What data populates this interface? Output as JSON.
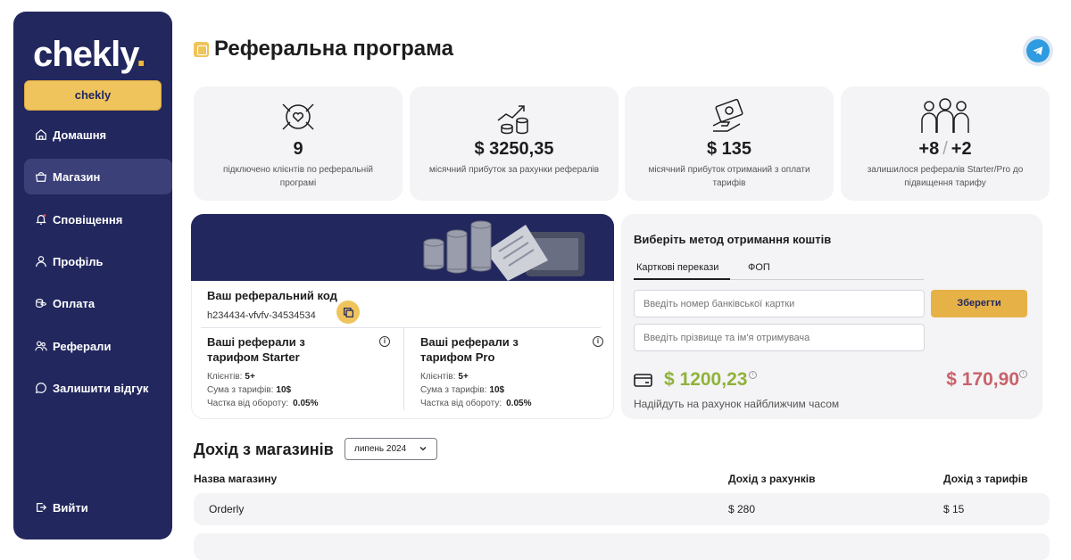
{
  "sidebar": {
    "logo_text": "chekly",
    "logo_dot": ".",
    "user_button": "chekly",
    "items": [
      {
        "label": "Домашня",
        "icon": "home-icon",
        "active": false
      },
      {
        "label": "Магазин",
        "icon": "store-icon",
        "active": true
      },
      {
        "label": "Сповіщення",
        "icon": "bell-icon",
        "active": false
      },
      {
        "label": "Профіль",
        "icon": "user-icon",
        "active": false
      },
      {
        "label": "Оплата",
        "icon": "coins-icon",
        "active": false
      },
      {
        "label": "Реферали",
        "icon": "users-icon",
        "active": false
      },
      {
        "label": "Залишити відгук",
        "icon": "chat-icon",
        "active": false
      }
    ],
    "logout": "Вийти"
  },
  "header": {
    "title": "Реферальна програма"
  },
  "stats": [
    {
      "value": "9",
      "desc": "підключено клієнтів по реферальній програмі",
      "icon": "handshake-heart-icon"
    },
    {
      "value": "$ 3250,35",
      "desc": "місячний прибуток за рахунки рефералів",
      "icon": "growth-coins-icon"
    },
    {
      "value": "$ 135",
      "desc": "місячний прибуток отриманий з оплати тарифів",
      "icon": "money-hand-icon"
    },
    {
      "value_a": "+8",
      "value_sep": "/",
      "value_b": "+2",
      "desc": "залишилося рефералів Starter/Pro до підвищення тарифу",
      "icon": "team-icon"
    }
  ],
  "referral": {
    "code_label": "Ваш реферальний код",
    "code": "h234434-vfvfv-34534534",
    "tiers": [
      {
        "title": "Ваші реферали з тарифом Starter",
        "clients_label": "Клієнтів:",
        "clients": "5+",
        "sum_label": "Сума з тарифів:",
        "sum": "10$",
        "share_label": "Частка від обороту:",
        "share": "0.05%"
      },
      {
        "title": "Ваші реферали з тарифом Pro",
        "clients_label": "Клієнтів:",
        "clients": "5+",
        "sum_label": "Сума з тарифів:",
        "sum": "10$",
        "share_label": "Частка від обороту:",
        "share": "0.05%"
      }
    ]
  },
  "payout": {
    "title": "Виберіть метод отримання коштів",
    "tabs": [
      "Карткові перекази",
      "ФОП"
    ],
    "card_placeholder": "Введіть номер банківської картки",
    "name_placeholder": "Введіть прізвище та ім'я отримувача",
    "save_label": "Зберегти",
    "amount_available": "$ 1200,23",
    "amount_pending": "$ 170,90",
    "note": "Надійдуть на рахунок найближчим часом",
    "colors": {
      "available": "#8fb339",
      "pending": "#c9616a"
    }
  },
  "income": {
    "title": "Дохід з магазинів",
    "month": "липень 2024",
    "columns": [
      "Назва магазину",
      "Дохід з рахунків",
      "Дохід з тарифів"
    ],
    "rows": [
      {
        "name": "Orderly",
        "invoices": "$ 280",
        "tariffs": "$ 15"
      }
    ]
  },
  "colors": {
    "sidebar": "#22275e",
    "accent": "#efc45c",
    "card": "#f4f4f6"
  }
}
